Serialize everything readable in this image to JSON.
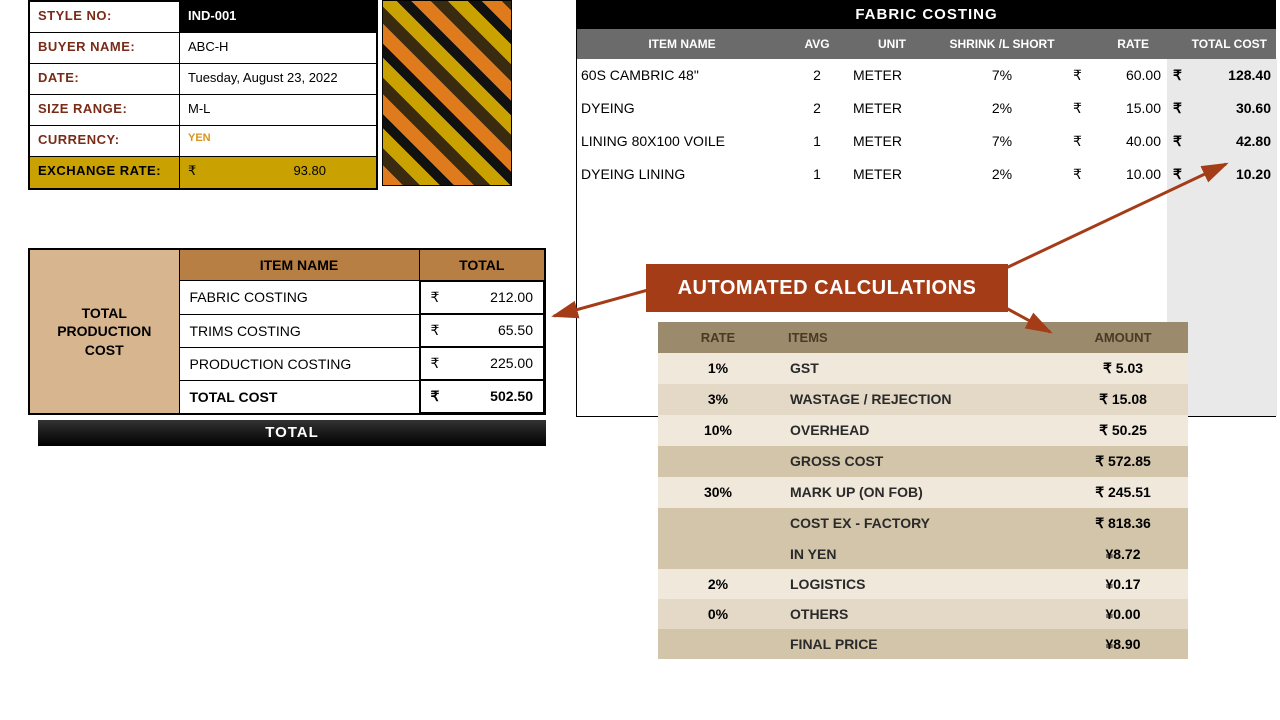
{
  "info": {
    "style_no_label": "STYLE NO:",
    "style_no": "IND-001",
    "buyer_label": "BUYER NAME:",
    "buyer": "ABC-H",
    "date_label": "DATE:",
    "date": "Tuesday, August 23, 2022",
    "size_label": "SIZE RANGE:",
    "size": "M-L",
    "currency_label": "CURRENCY:",
    "currency": "YEN",
    "exrate_label": "EXCHANGE RATE:",
    "exrate_symbol": "₹",
    "exrate": "93.80"
  },
  "prod": {
    "side_header": "TOTAL PRODUCTION COST",
    "col_item": "ITEM NAME",
    "col_total": "TOTAL",
    "rows": [
      {
        "name": "FABRIC COSTING",
        "sym": "₹",
        "val": "212.00"
      },
      {
        "name": "TRIMS COSTING",
        "sym": "₹",
        "val": "65.50"
      },
      {
        "name": "PRODUCTION COSTING",
        "sym": "₹",
        "val": "225.00"
      }
    ],
    "total_label": "TOTAL COST",
    "total_sym": "₹",
    "total_val": "502.50",
    "total_bar": "TOTAL"
  },
  "fabric": {
    "title": "FABRIC COSTING",
    "head": {
      "item": "ITEM NAME",
      "avg": "AVG",
      "unit": "UNIT",
      "shrink": "SHRINK /L SHORT",
      "rate": "RATE",
      "tcost": "TOTAL COST"
    },
    "rows": [
      {
        "name": "60S CAMBRIC 48\"",
        "avg": "2",
        "unit": "METER",
        "shrink": "7%",
        "rsym": "₹",
        "rate": "60.00",
        "tsym": "₹",
        "tcost": "128.40"
      },
      {
        "name": "DYEING",
        "avg": "2",
        "unit": "METER",
        "shrink": "2%",
        "rsym": "₹",
        "rate": "15.00",
        "tsym": "₹",
        "tcost": "30.60"
      },
      {
        "name": "LINING 80X100 VOILE",
        "avg": "1",
        "unit": "METER",
        "shrink": "7%",
        "rsym": "₹",
        "rate": "40.00",
        "tsym": "₹",
        "tcost": "42.80"
      },
      {
        "name": "DYEING LINING",
        "avg": "1",
        "unit": "METER",
        "shrink": "2%",
        "rsym": "₹",
        "rate": "10.00",
        "tsym": "₹",
        "tcost": "10.20"
      }
    ]
  },
  "callout": "AUTOMATED CALCULATIONS",
  "summary": {
    "head": {
      "rate": "RATE",
      "items": "ITEMS",
      "amount": "AMOUNT"
    },
    "rows": [
      {
        "rate": "1%",
        "item": "GST",
        "amount": "₹ 5.03",
        "shade": "a"
      },
      {
        "rate": "3%",
        "item": "WASTAGE / REJECTION",
        "amount": "₹ 15.08",
        "shade": "b"
      },
      {
        "rate": "10%",
        "item": "OVERHEAD",
        "amount": "₹ 50.25",
        "shade": "a"
      },
      {
        "rate": "",
        "item": "GROSS COST",
        "amount": "₹ 572.85",
        "shade": "c"
      },
      {
        "rate": "30%",
        "item": "MARK UP (ON FOB)",
        "amount": "₹ 245.51",
        "shade": "a"
      },
      {
        "rate": "",
        "item": "COST EX - FACTORY",
        "amount": "₹ 818.36",
        "shade": "c"
      },
      {
        "rate": "",
        "item": "IN YEN",
        "amount": "¥8.72",
        "shade": "c"
      },
      {
        "rate": "2%",
        "item": "LOGISTICS",
        "amount": "¥0.17",
        "shade": "a"
      },
      {
        "rate": "0%",
        "item": "OTHERS",
        "amount": "¥0.00",
        "shade": "b"
      },
      {
        "rate": "",
        "item": "FINAL PRICE",
        "amount": "¥8.90",
        "shade": "c"
      }
    ]
  }
}
